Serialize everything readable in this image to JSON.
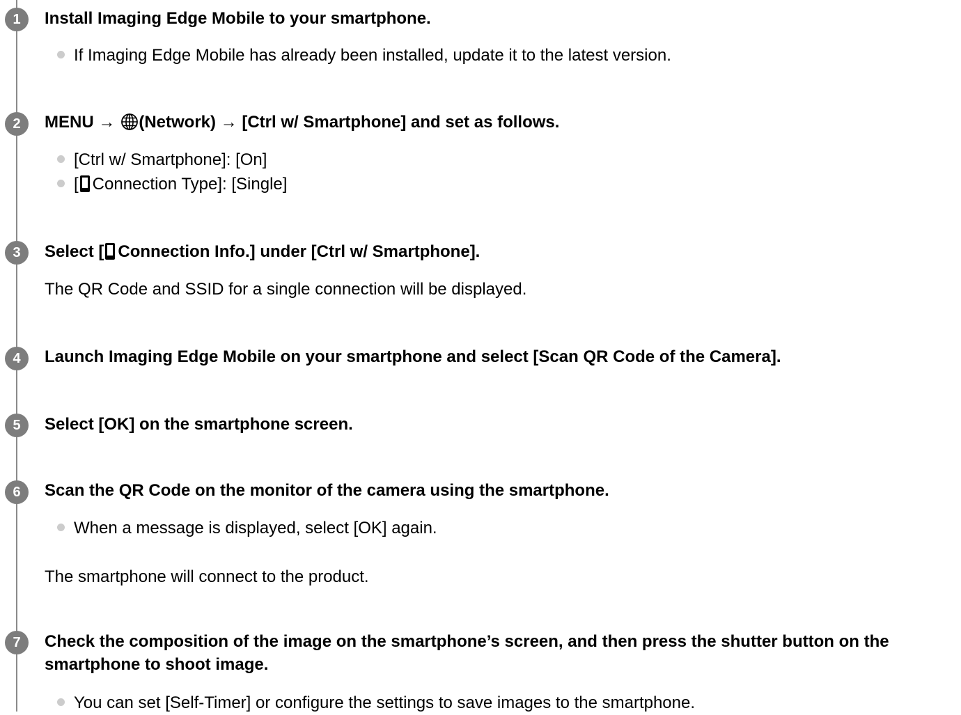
{
  "steps": [
    {
      "number": "1",
      "title": "Install Imaging Edge Mobile to your smartphone.",
      "bullets": [
        "If Imaging Edge Mobile has already been installed, update it to the latest version."
      ]
    },
    {
      "number": "2",
      "title_prefix": "MENU →",
      "title_suffix": "(Network) → [Ctrl w/ Smartphone] and set as follows.",
      "bullets": [
        "[Ctrl w/ Smartphone]: [On]"
      ],
      "bullet2_prefix": "[",
      "bullet2_suffix": "Connection Type]: [Single]"
    },
    {
      "number": "3",
      "title_prefix": "Select [",
      "title_suffix": "Connection Info.] under [Ctrl w/ Smartphone].",
      "paragraph": "The QR Code and SSID for a single connection will be displayed."
    },
    {
      "number": "4",
      "title": "Launch Imaging Edge Mobile on your smartphone and select [Scan QR Code of the Camera]."
    },
    {
      "number": "5",
      "title": "Select [OK] on the smartphone screen."
    },
    {
      "number": "6",
      "title": "Scan the QR Code on the monitor of the camera using the smartphone.",
      "bullets": [
        "When a message is displayed, select [OK] again."
      ],
      "paragraph": "The smartphone will connect to the product."
    },
    {
      "number": "7",
      "title": "Check the composition of the image on the smartphone’s screen, and then press the shutter button on the smartphone to shoot image.",
      "bullets": [
        "You can set [Self-Timer] or configure the settings to save images to the smartphone."
      ]
    }
  ],
  "icons": {
    "network": "globe-icon",
    "smartphone": "smartphone-icon"
  },
  "colors": {
    "step_circle": "#7d7d7d",
    "timeline": "#8a8a8a",
    "bullet": "#cccccc"
  }
}
